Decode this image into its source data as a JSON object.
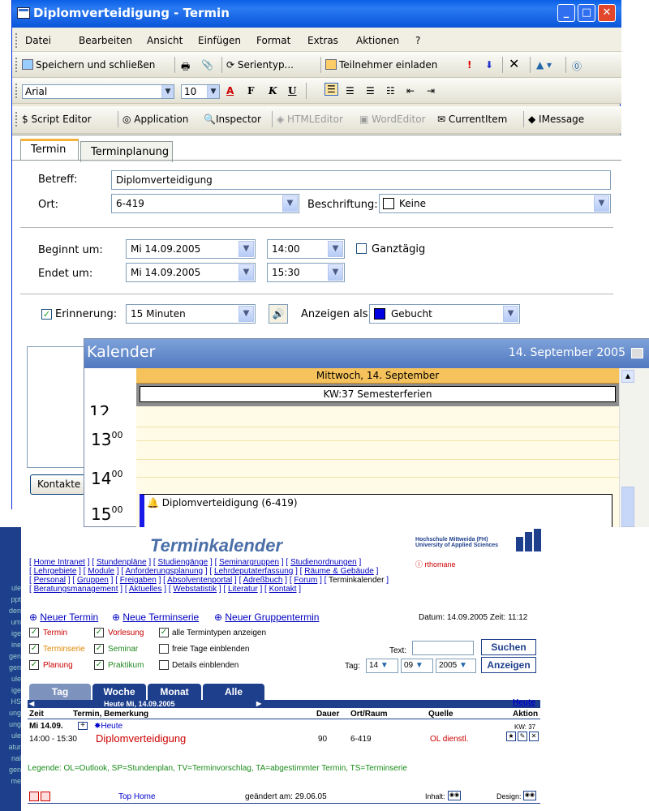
{
  "window": {
    "title": "Diplomverteidigung - Termin",
    "caption_buttons": [
      "_",
      "□",
      "X"
    ]
  },
  "menu": [
    "Datei",
    "Bearbeiten",
    "Ansicht",
    "Einfügen",
    "Format",
    "Extras",
    "Aktionen",
    "?"
  ],
  "toolbar1": {
    "save_close": "Speichern und schließen",
    "series": "Serientyp...",
    "invite": "Teilnehmer einladen"
  },
  "toolbar2": {
    "font": "Arial",
    "size": "10",
    "bold": "F",
    "italic": "K",
    "underline": "U"
  },
  "toolbar3": {
    "script_editor": "Script Editor",
    "application": "Application",
    "inspector": "Inspector",
    "html_editor": "HTMLEditor",
    "word_editor": "WordEditor",
    "current_item": "CurrentItem",
    "imessage": "IMessage"
  },
  "form": {
    "tabs": [
      "Termin",
      "Terminplanung"
    ],
    "betreff_label": "Betreff:",
    "betreff_value": "Diplomverteidigung",
    "ort_label": "Ort:",
    "ort_value": "6-419",
    "beschriftung_label": "Beschriftung:",
    "beschriftung_value": "Keine",
    "beginnt_label": "Beginnt um:",
    "beginnt_date": "Mi 14.09.2005",
    "beginnt_time": "14:00",
    "ganztaegig_label": "Ganztägig",
    "endet_label": "Endet um:",
    "endet_date": "Mi 14.09.2005",
    "endet_time": "15:30",
    "erinnerung_label": "Erinnerung:",
    "erinnerung_value": "15 Minuten",
    "anzeigen_label": "Anzeigen als:",
    "anzeigen_value": "Gebucht",
    "kontakte_button": "Kontakte"
  },
  "calendar": {
    "title": "Kalender",
    "date": "14. September 2005",
    "day_header": "Mittwoch, 14. September",
    "week_banner": "KW:37  Semesterferien",
    "hours": [
      {
        "h": "12",
        "m": ""
      },
      {
        "h": "13",
        "m": "00"
      },
      {
        "h": "14",
        "m": "00"
      },
      {
        "h": "15",
        "m": "00"
      }
    ],
    "appointment": "Diplomverteidigung (6-419)"
  },
  "web": {
    "title": "Terminkalender",
    "school_line1": "Hochschule Mittweida (FH)",
    "school_line2": "University of Applied Sciences",
    "user": "rthomane",
    "nav_rows": [
      [
        "Home Intranet",
        "Stundenpläne",
        "Studiengänge",
        "Seminargruppen",
        "Studienordnungen"
      ],
      [
        "Lehrgebiete",
        "Module",
        "Anforderungsplanung",
        "Lehrdeputaterfassung",
        "Räume & Gebäude"
      ],
      [
        "Personal",
        "Gruppen",
        "Freigaben",
        "Absolventenportal",
        "Adreßbuch",
        "Forum",
        "Terminkalender"
      ],
      [
        "Beratungsmanagement",
        "Aktuelles",
        "Webstatistik",
        "Literatur",
        "Kontakt"
      ]
    ],
    "actions": [
      "Neuer Termin",
      "Neue Terminserie",
      "Neuer Gruppentermin"
    ],
    "datetime": "Datum: 14.09.2005  Zeit: 11:12",
    "checks": [
      {
        "label": "Termin",
        "color": "#cc0000"
      },
      {
        "label": "Vorlesung",
        "color": "#cc0000"
      },
      {
        "label": "alle Termintypen anzeigen",
        "color": "#000000"
      },
      {
        "label": "Terminserie",
        "color": "#dd8800"
      },
      {
        "label": "Seminar",
        "color": "#228822"
      },
      {
        "label": "freie Tage einblenden",
        "color": "#000000"
      },
      {
        "label": "Planung",
        "color": "#cc0000"
      },
      {
        "label": "Praktikum",
        "color": "#228822"
      },
      {
        "label": "Details einblenden",
        "color": "#000000"
      }
    ],
    "text_label": "Text:",
    "tag_label": "Tag:",
    "tag": "14",
    "monat": "09",
    "jahr": "2005",
    "suchen": "Suchen",
    "anzeigen": "Anzeigen",
    "view_tabs": [
      "Tag",
      "Woche",
      "Monat",
      "Alle"
    ],
    "today_bar": "Heute Mi, 14.09.2005",
    "heute_link": "Heute",
    "columns": [
      "Zeit",
      "Termin, Bemerkung",
      "Dauer",
      "Ort/Raum",
      "Quelle",
      "Aktion"
    ],
    "day_row_date": "Mi  14.09.",
    "day_row_heute": "Heute",
    "day_row_kw": "KW: 37",
    "entry_time": "14:00 - 15:30",
    "entry_title": "Diplomverteidigung",
    "entry_duration": "90",
    "entry_room": "6-419",
    "entry_source": "OL dienstl.",
    "legend": "Legende: OL=Outlook, SP=Stundenplan, TV=Terminvorschlag, TA=abgestimmter Termin, TS=Terminserie",
    "footer_top": "Top Home",
    "footer_changed": "geändert am: 29.06.05",
    "footer_inhalt": "Inhalt:",
    "footer_design": "Design:",
    "leftnav": [
      "ule",
      "ppt",
      "den",
      "um",
      "ige",
      "ine",
      "gen",
      "gen",
      "ule",
      "ige",
      "HS",
      "ung",
      "ung",
      "ule",
      "atur",
      "nal",
      "gen",
      "me"
    ]
  }
}
